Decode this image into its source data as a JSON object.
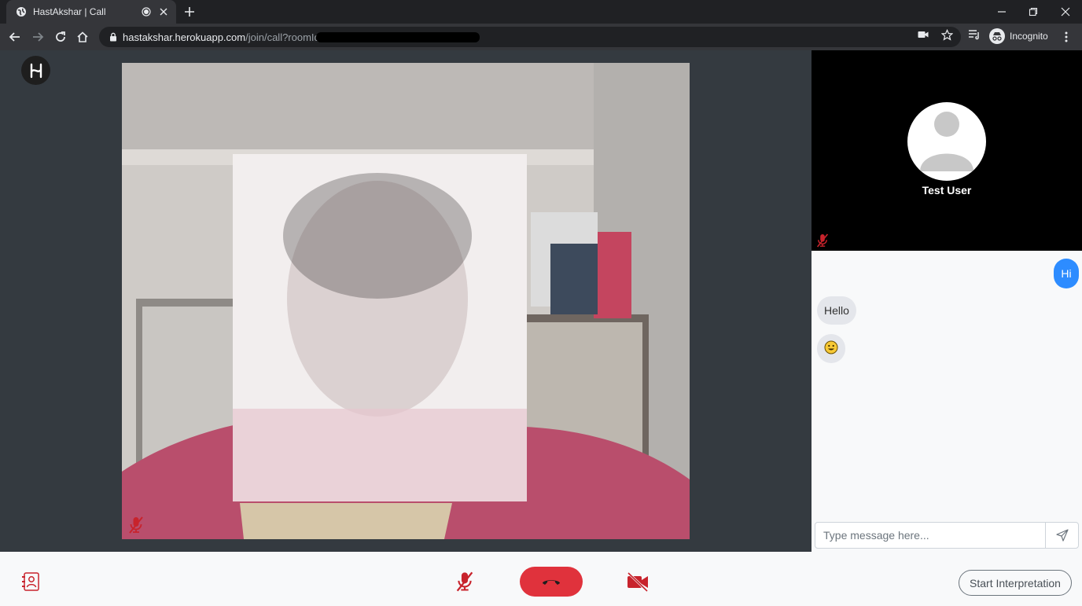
{
  "browser": {
    "tab_title": "HastAkshar | Call",
    "url_host": "hastakshar.herokuapp.com",
    "url_path": "/join/call?roomId=",
    "profile_label": "Incognito"
  },
  "icons": {
    "favicon": "globe-icon",
    "tab_audio": "recording-dot-icon",
    "back": "arrow-left-icon",
    "forward": "arrow-right-icon",
    "reload": "reload-icon",
    "home": "home-icon",
    "camera": "camera-icon",
    "bookmark": "star-icon",
    "media": "media-queue-icon",
    "mic_muted": "mic-off-icon",
    "video_off": "video-off-icon",
    "end_call": "phone-hangup-icon",
    "send": "send-icon",
    "contacts": "contacts-icon"
  },
  "peer": {
    "name": "Test User"
  },
  "chat": {
    "messages": [
      {
        "from": "me",
        "text": "Hi"
      },
      {
        "from": "peer",
        "text": "Hello"
      },
      {
        "from": "peer",
        "text": "😀"
      }
    ],
    "placeholder": "Type message here..."
  },
  "controls": {
    "interpretation_label": "Start Interpretation"
  },
  "colors": {
    "accent_blue": "#2d8cff",
    "end_call_red": "#e0323c",
    "muted_red": "#c8232c",
    "stage_bg": "#343a40"
  }
}
